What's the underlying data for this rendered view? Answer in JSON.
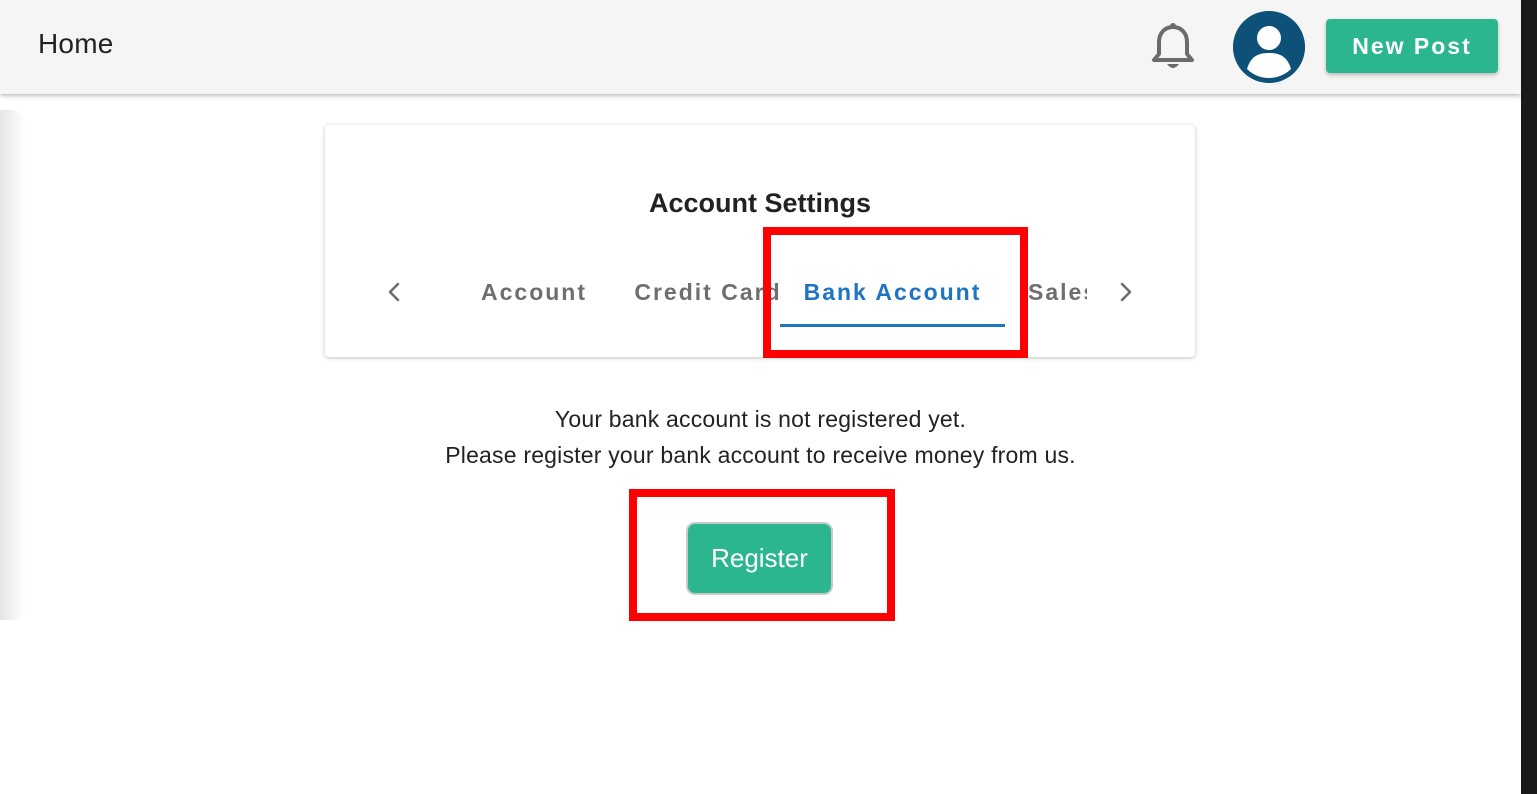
{
  "appbar": {
    "title": "Home",
    "new_post_label": "New Post",
    "bell_icon": "bell-icon",
    "avatar_icon": "account-circle-icon"
  },
  "settings": {
    "title": "Account Settings",
    "tabs": [
      {
        "label": "Account",
        "active": false
      },
      {
        "label": "Credit Card",
        "active": false
      },
      {
        "label": "Bank Account",
        "active": true
      },
      {
        "label": "Sales",
        "active": false
      }
    ],
    "prev_icon": "chevron-left-icon",
    "next_icon": "chevron-right-icon"
  },
  "bank": {
    "message_line1": "Your bank account is not registered yet.",
    "message_line2": "Please register your bank account to receive money from us.",
    "register_label": "Register"
  },
  "colors": {
    "accent_green": "#2bb690",
    "active_tab_blue": "#1f74c4",
    "avatar_blue": "#0d5078",
    "highlight_red": "#ff0000"
  }
}
